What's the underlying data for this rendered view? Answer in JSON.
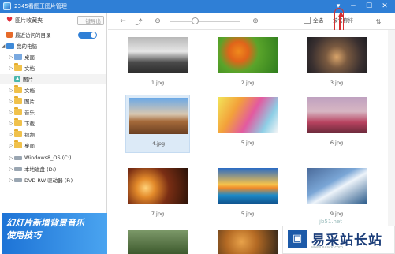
{
  "window": {
    "title": "2345看图王图片管理",
    "menu_icon": "▾",
    "min_icon": "─",
    "max_icon": "☐",
    "close_icon": "✕"
  },
  "sidebar": {
    "favorites_label": "图片收藏夹",
    "export_label": "一键导出",
    "recent_label": "最近访问的目录",
    "recent_toggle_on": true,
    "computer_label": "我的电脑",
    "tree": [
      {
        "label": "桌面",
        "icon": "desktop-icon"
      },
      {
        "label": "文档",
        "icon": "folder-icon"
      },
      {
        "label": "图片",
        "icon": "image-icon"
      },
      {
        "label": "文档",
        "icon": "folder-icon"
      },
      {
        "label": "图片",
        "icon": "folder-icon"
      },
      {
        "label": "音乐",
        "icon": "folder-icon"
      },
      {
        "label": "下载",
        "icon": "folder-icon"
      },
      {
        "label": "视频",
        "icon": "folder-icon"
      },
      {
        "label": "桌面",
        "icon": "folder-icon"
      },
      {
        "label": "Windows8_OS (C:)",
        "icon": "drive-icon"
      },
      {
        "label": "本地磁盘 (D:)",
        "icon": "drive-icon"
      },
      {
        "label": "DVD RW 驱动器 (F:)",
        "icon": "dvd-icon"
      }
    ],
    "banner_line1": "幻灯片新增背景音乐",
    "banner_line2": "使用技巧"
  },
  "toolbar": {
    "back_icon": "←",
    "up_icon": "⤴",
    "zoom_out_icon": "⊖",
    "zoom_in_icon": "⊕",
    "select_all_label": "全选",
    "sort_label": "按名称排",
    "sort_icon": "⇅",
    "zoom_level": 0.35
  },
  "thumbnails": [
    {
      "name": "1.jpg"
    },
    {
      "name": "2.jpg"
    },
    {
      "name": "3.jpg"
    },
    {
      "name": "4.jpg"
    },
    {
      "name": "5.jpg"
    },
    {
      "name": "6.jpg"
    },
    {
      "name": "7.jpg"
    },
    {
      "name": "5.jpg"
    },
    {
      "name": "9.jpg"
    }
  ],
  "watermark": {
    "logo_char": "▣",
    "site_name": "易采站长站",
    "url": "www.easck.com",
    "url2": "jb51.net"
  }
}
